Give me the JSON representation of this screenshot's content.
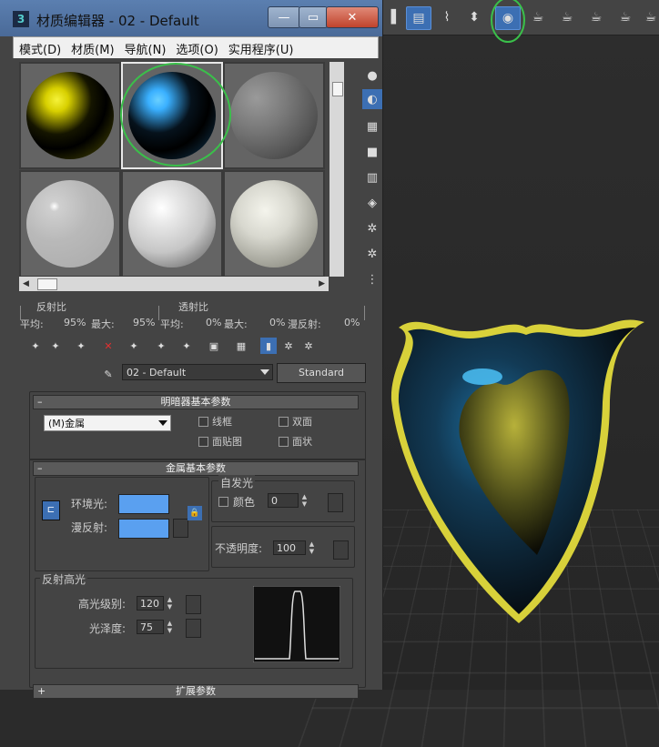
{
  "window": {
    "title": "材质编辑器 - 02 - Default",
    "icon_name": "3dsmax-app-icon",
    "controls": {
      "minimize": "—",
      "maximize": "▭",
      "close": "✕"
    }
  },
  "menu": [
    "模式(D)",
    "材质(M)",
    "导航(N)",
    "选项(O)",
    "实用程序(U)"
  ],
  "slots": [
    {
      "name": "slot-1",
      "type": "metal-yellow",
      "selected": false
    },
    {
      "name": "slot-2",
      "type": "metal-blue",
      "selected": true
    },
    {
      "name": "slot-3",
      "type": "gray",
      "selected": false
    },
    {
      "name": "slot-4",
      "type": "glossy-gray",
      "selected": false
    },
    {
      "name": "slot-5",
      "type": "white",
      "selected": false
    },
    {
      "name": "slot-6",
      "type": "white-soft",
      "selected": false
    }
  ],
  "stats": {
    "reflect_label": "反射比",
    "transmit_label": "透射比",
    "avg_label": "平均:",
    "max_label": "最大:",
    "diffuse_label": "漫反射:",
    "reflect_avg": "95%",
    "reflect_max": "95%",
    "transmit_avg": "0%",
    "transmit_max": "0%",
    "diffuse_val": "0%"
  },
  "material": {
    "name": "02 - Default",
    "type_button": "Standard"
  },
  "shader_rollout": {
    "title": "明暗器基本参数",
    "minus": "–",
    "shader": "(M)金属",
    "options": {
      "wire": "线框",
      "two_sided": "双面",
      "face_map": "面贴图",
      "faceted": "面状"
    }
  },
  "metal_rollout": {
    "title": "金属基本参数",
    "minus": "–",
    "self_illum_title": "自发光",
    "ambient_label": "环境光:",
    "diffuse_label": "漫反射:",
    "color_label": "颜色",
    "color_value": "0",
    "opacity_label": "不透明度:",
    "opacity_value": "100",
    "specular_title": "反射高光",
    "spec_level_label": "高光级别:",
    "spec_level_value": "120",
    "gloss_label": "光泽度:",
    "gloss_value": "75",
    "swatch_color": "#5aa0f0"
  },
  "bottom_rollout": {
    "title": "扩展参数",
    "plus": "+"
  },
  "colors": {
    "title_bar": "#4a6a98",
    "accent": "#3c6fb3",
    "object_yellow": "#d8d13a"
  }
}
